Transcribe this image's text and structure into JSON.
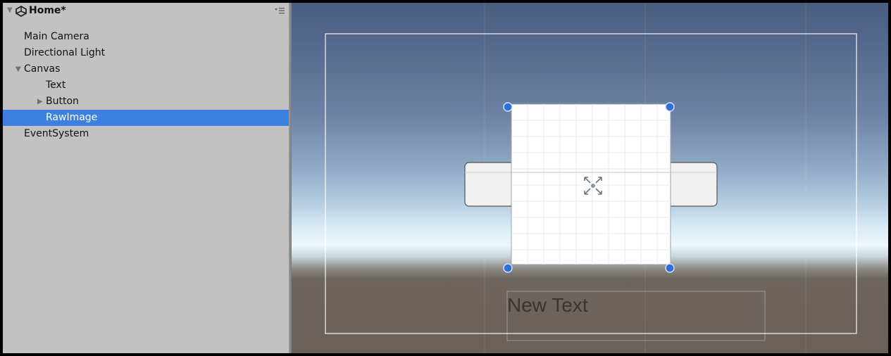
{
  "hierarchy": {
    "scene_name": "Home*",
    "items": [
      {
        "label": "Main Camera",
        "arrow": ""
      },
      {
        "label": "Directional Light",
        "arrow": ""
      },
      {
        "label": "Canvas",
        "arrow": "▼"
      },
      {
        "label": "Text",
        "arrow": ""
      },
      {
        "label": "Button",
        "arrow": "▶"
      },
      {
        "label": "RawImage",
        "arrow": "",
        "selected": true
      },
      {
        "label": "EventSystem",
        "arrow": ""
      }
    ]
  },
  "scene": {
    "text_label": "New Text"
  },
  "colors": {
    "selection": "#3d80df",
    "handle": "#2f6fd6",
    "panel_bg": "#c2c2c2"
  },
  "icons": [
    "unity-scene-icon",
    "dropdown-menu-icon",
    "fold-arrow-icon",
    "rawimage-gizmo-icon"
  ]
}
